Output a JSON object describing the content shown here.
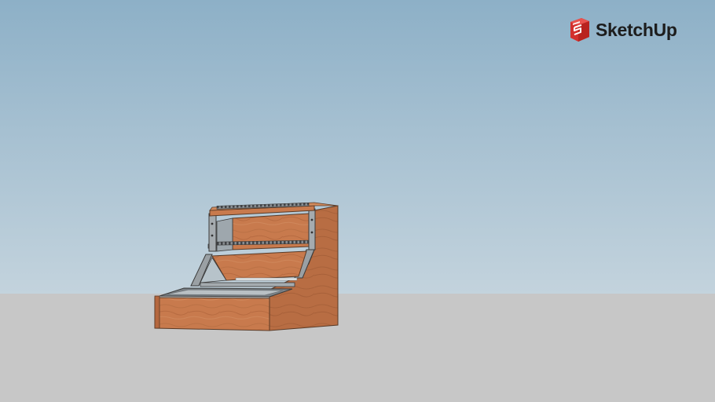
{
  "brand": {
    "name": "SketchUp",
    "logo_icon": "sketchup-logo-icon",
    "accent_color": "#d3302d"
  },
  "scene": {
    "sky_color_top": "#8db0c7",
    "sky_color_bottom": "#c3d3dd",
    "ground_color": "#c7c7c7",
    "model_subject": "wooden-stepped-rack-cabinet"
  }
}
